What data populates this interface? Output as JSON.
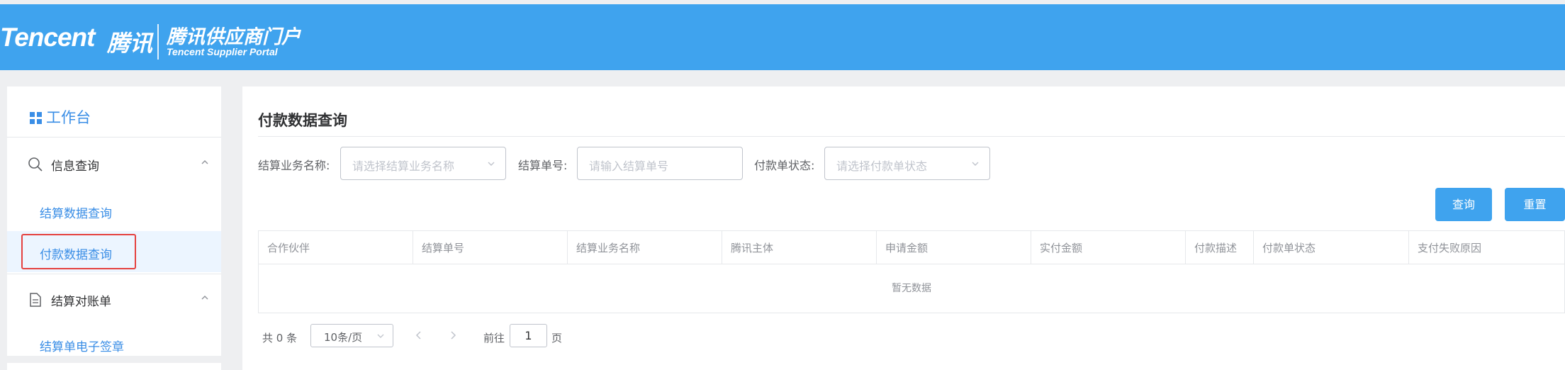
{
  "header": {
    "logo_text": "Tencent",
    "logo_cn": "腾讯",
    "portal_title_cn": "腾讯供应商门户",
    "portal_title_en": "Tencent Supplier Portal"
  },
  "sidebar": {
    "workbench_label": "工作台",
    "groups": [
      {
        "label": "信息查询",
        "icon": "search-icon",
        "items": [
          {
            "label": "结算数据查询",
            "active": false
          },
          {
            "label": "付款数据查询",
            "active": true
          }
        ]
      },
      {
        "label": "结算对账单",
        "icon": "document-icon",
        "items": [
          {
            "label": "结算单电子签章",
            "active": false
          }
        ]
      }
    ]
  },
  "main": {
    "page_title": "付款数据查询",
    "filters": {
      "business_name_label": "结算业务名称:",
      "business_name_placeholder": "请选择结算业务名称",
      "order_no_label": "结算单号:",
      "order_no_placeholder": "请输入结算单号",
      "status_label": "付款单状态:",
      "status_placeholder": "请选择付款单状态"
    },
    "buttons": {
      "query": "查询",
      "reset": "重置"
    },
    "table": {
      "columns": [
        "合作伙伴",
        "结算单号",
        "结算业务名称",
        "腾讯主体",
        "申请金额",
        "实付金额",
        "付款描述",
        "付款单状态",
        "支付失败原因"
      ],
      "empty_text": "暂无数据"
    },
    "pagination": {
      "total_text": "共 0 条",
      "page_size": "10条/页",
      "goto_prefix": "前往",
      "current_page": "1",
      "goto_suffix": "页"
    }
  },
  "colors": {
    "header_bg": "#3fa3ee",
    "accent": "#3a8ee6",
    "highlight_border": "#e5413f",
    "page_bg": "#eeeff1"
  }
}
